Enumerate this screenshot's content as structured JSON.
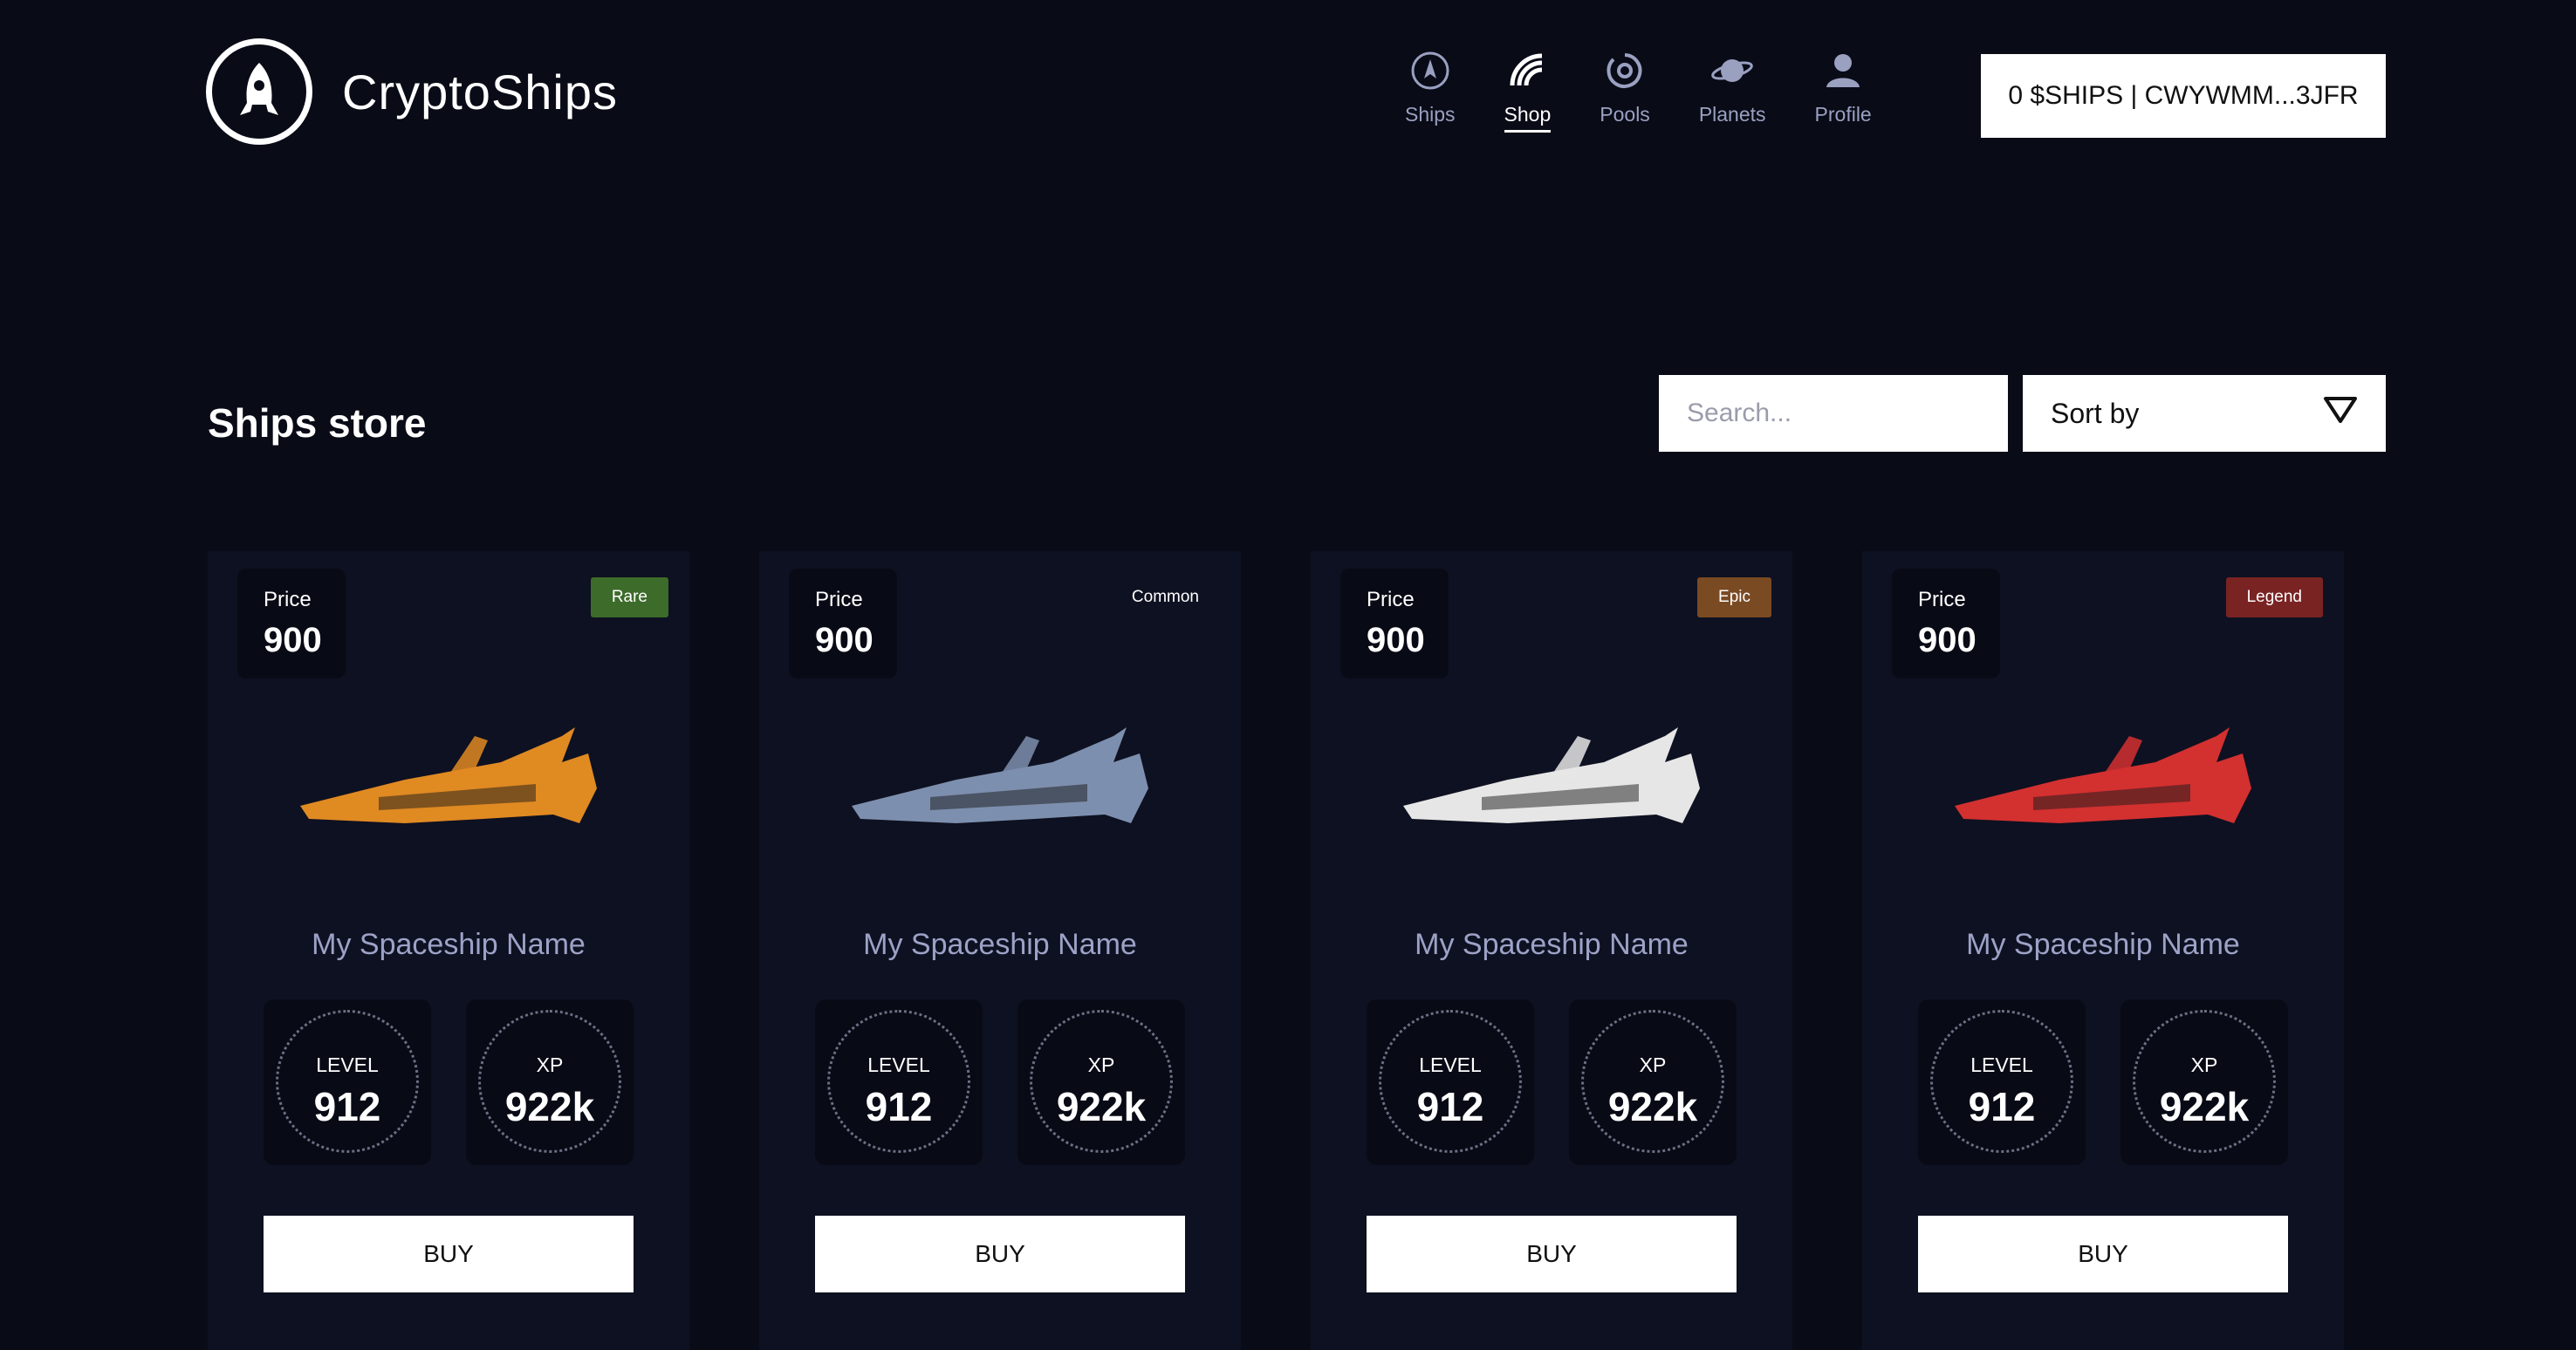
{
  "app": {
    "title": "CryptoShips"
  },
  "nav": [
    {
      "label": "Ships",
      "icon": "rocket-circle-icon",
      "active": false
    },
    {
      "label": "Shop",
      "icon": "signal-icon",
      "active": true
    },
    {
      "label": "Pools",
      "icon": "target-icon",
      "active": false
    },
    {
      "label": "Planets",
      "icon": "planet-icon",
      "active": false
    },
    {
      "label": "Profile",
      "icon": "user-icon",
      "active": false
    }
  ],
  "wallet": {
    "label": "0 $SHIPS | CWYWMM...3JFR"
  },
  "store": {
    "title": "Ships store",
    "search_placeholder": "Search...",
    "sort_label": "Sort by"
  },
  "cards": [
    {
      "price_label": "Price",
      "price": "900",
      "rarity": "Rare",
      "rarity_color": "#3d6b2a",
      "name": "My Spaceship Name",
      "level_label": "LEVEL",
      "level": "912",
      "xp_label": "XP",
      "xp": "922k",
      "buy_label": "BUY",
      "ship_color": "#e08a22"
    },
    {
      "price_label": "Price",
      "price": "900",
      "rarity": "Common",
      "rarity_color": "transparent",
      "name": "My Spaceship Name",
      "level_label": "LEVEL",
      "level": "912",
      "xp_label": "XP",
      "xp": "922k",
      "buy_label": "BUY",
      "ship_color": "#7d8fae"
    },
    {
      "price_label": "Price",
      "price": "900",
      "rarity": "Epic",
      "rarity_color": "#7a4a22",
      "name": "My Spaceship Name",
      "level_label": "LEVEL",
      "level": "912",
      "xp_label": "XP",
      "xp": "922k",
      "buy_label": "BUY",
      "ship_color": "#e6e6e6"
    },
    {
      "price_label": "Price",
      "price": "900",
      "rarity": "Legend",
      "rarity_color": "#7a2323",
      "name": "My Spaceship Name",
      "level_label": "LEVEL",
      "level": "912",
      "xp_label": "XP",
      "xp": "922k",
      "buy_label": "BUY",
      "ship_color": "#d33030"
    }
  ]
}
